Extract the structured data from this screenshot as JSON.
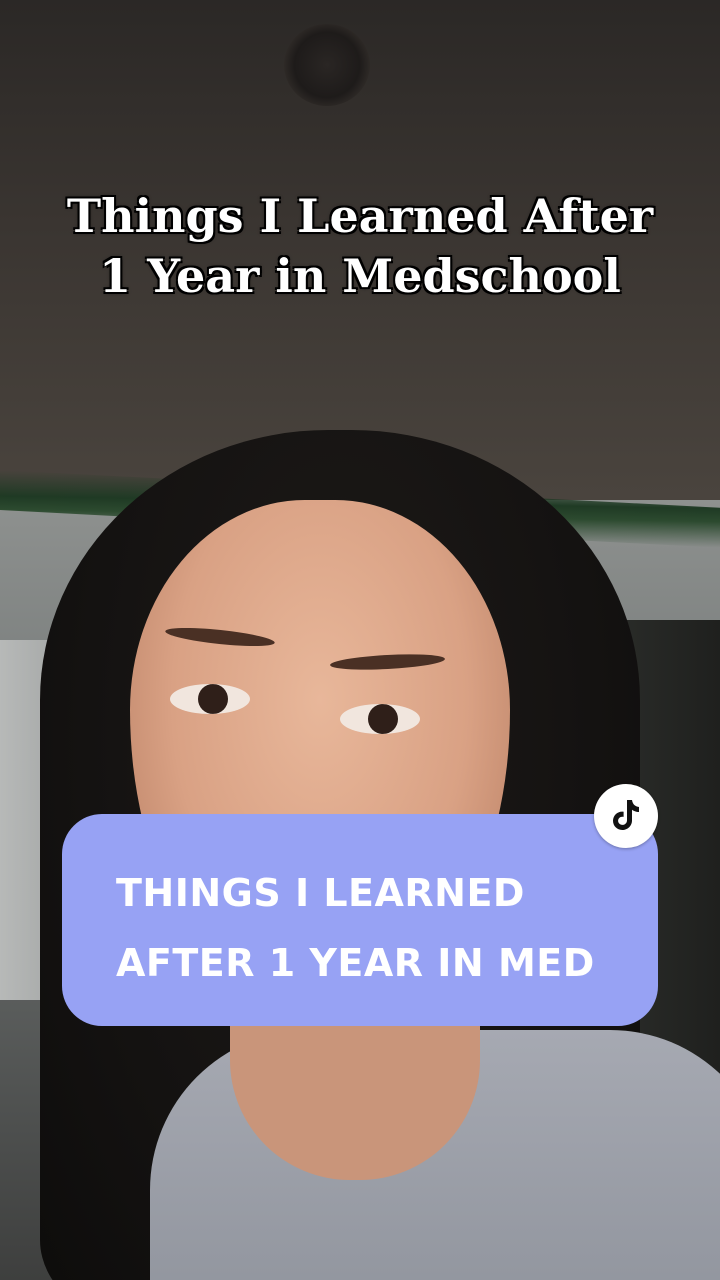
{
  "headline": {
    "line1": "Things I Learned After",
    "line2": "1 Year in Medschool"
  },
  "caption": {
    "line1": "THINGS I LEARNED",
    "line2": "AFTER 1 YEAR IN MED",
    "background_color": "#97a2f4"
  },
  "badge": {
    "icon": "tiktok-logo-icon"
  }
}
